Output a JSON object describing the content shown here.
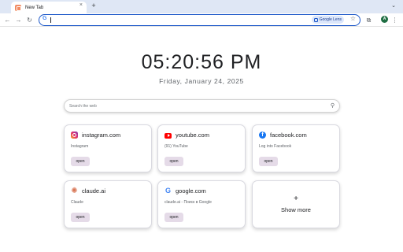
{
  "browser": {
    "tab_title": "New Tab",
    "tab_close": "×",
    "new_tab": "+",
    "back": "←",
    "forward": "→",
    "reload": "↻",
    "omnibox_value": "",
    "lens_label": "Google Lens",
    "profile_initial": "A",
    "accent_color": "#1a56c8"
  },
  "clock": {
    "time": "05:20:56 PM",
    "date": "Friday, January 24, 2025"
  },
  "search": {
    "placeholder": "Search the web"
  },
  "shortcuts": [
    {
      "site": "instagram.com",
      "description": "Instagram",
      "button": "open",
      "icon": "instagram-icon"
    },
    {
      "site": "youtube.com",
      "description": "(91) YouTube",
      "button": "open",
      "icon": "youtube-icon"
    },
    {
      "site": "facebook.com",
      "description": "Log into Facebook",
      "button": "open",
      "icon": "facebook-icon"
    },
    {
      "site": "claude.ai",
      "description": "Claude",
      "button": "open",
      "icon": "claude-icon"
    },
    {
      "site": "google.com",
      "description": "claude.ai - Поиск в Google",
      "button": "open",
      "icon": "google-icon"
    }
  ],
  "show_more": {
    "symbol": "+",
    "label": "Show more"
  }
}
